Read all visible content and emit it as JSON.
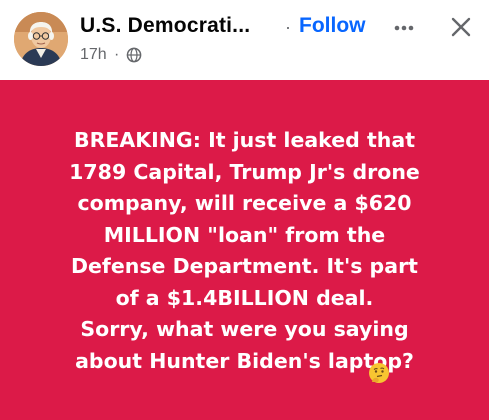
{
  "post": {
    "author": "U.S. Democrati...",
    "separator": "·",
    "follow_label": "Follow",
    "timestamp": "17h",
    "meta_separator": "·",
    "audience_icon": "globe-icon",
    "more_icon": "more-horizontal-icon",
    "close_icon": "close-icon",
    "avatar_icon": "profile-portrait-avatar"
  },
  "card": {
    "background": "#dc1a48",
    "text_color": "#ffffff",
    "text": "BREAKING: It just leaked that\n1789 Capital, Trump Jr's drone\ncompany, will receive a $620\nMILLION \"loan\" from the\nDefense Department. It's part\nof a $1.4BILLION deal.    \nSorry, what were you saying\nabout Hunter Biden's laptop?",
    "emoji": "thinking-face-emoji"
  },
  "colors": {
    "link": "#0866ff",
    "secondary_text": "#65676b",
    "primary_text": "#050505"
  }
}
